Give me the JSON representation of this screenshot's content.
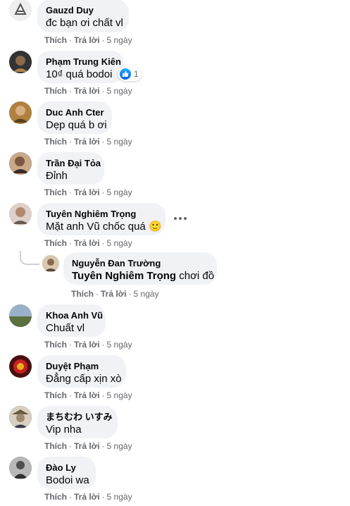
{
  "labels": {
    "like": "Thích",
    "reply": "Trả lời",
    "dot": "·"
  },
  "comments": [
    {
      "name": "Gauzd Duy",
      "text": "đc bạn ơi chất vl",
      "time": "5 ngày"
    },
    {
      "name": "Phạm Trung Kiên",
      "text": "10₫ quá bodoi",
      "time": "5 ngày",
      "reaction_count": "1"
    },
    {
      "name": "Duc Anh Cter",
      "text": "Dẹp quá b ơi",
      "time": "5 ngày"
    },
    {
      "name": "Trần Đại Tỏa",
      "text": "Đỉnh",
      "time": "5 ngày"
    },
    {
      "name": "Tuyên Nghiêm Trọng",
      "text": "Mặt anh Vũ chốc quá",
      "emoji": "🙂",
      "time": "5 ngày"
    },
    {
      "name": "Nguyễn Đan Trường",
      "mention": "Tuyên Nghiêm Trọng",
      "text": "chơi đồ",
      "time": "5 ngày"
    },
    {
      "name": "Khoa Anh Vũ",
      "text": "Chuất vl",
      "time": "5 ngày"
    },
    {
      "name": "Duyệt Phạm",
      "text": "Đẳng cấp xịn xò",
      "time": "5 ngày"
    },
    {
      "name": "まちむわ いすみ",
      "text": "Vip nha",
      "time": "5 ngày"
    },
    {
      "name": "Đào Ly",
      "text": "Bodoi wa",
      "time": "5 ngày"
    }
  ]
}
